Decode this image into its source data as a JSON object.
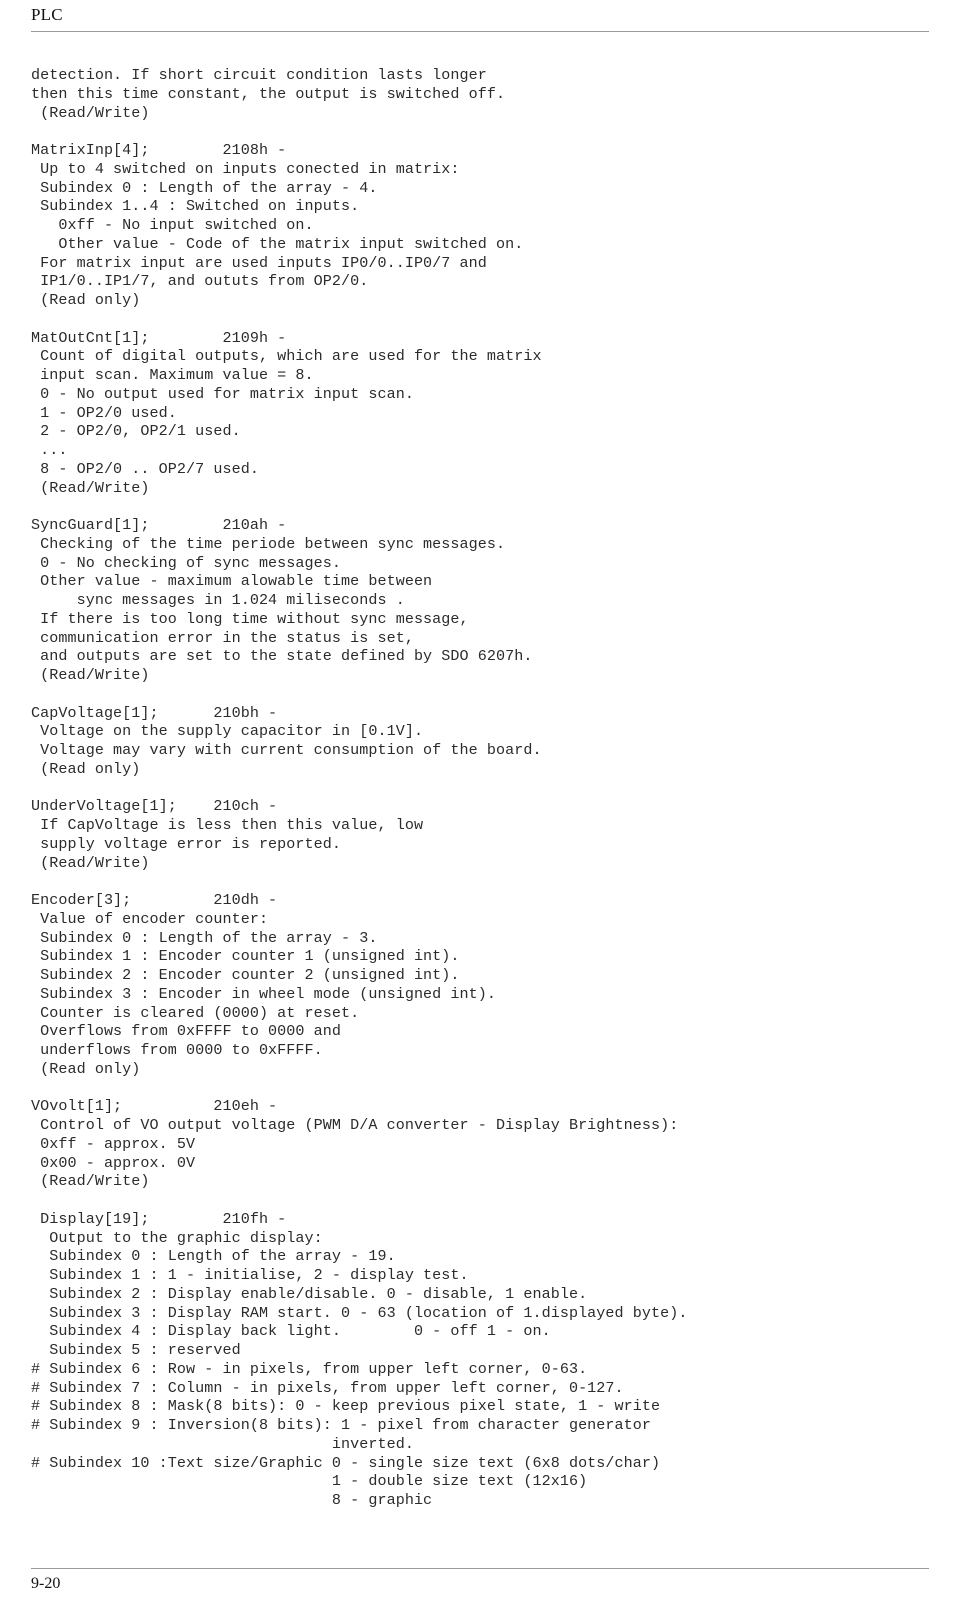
{
  "header": {
    "title": "PLC"
  },
  "footer": {
    "page_number": "9-20"
  },
  "document": {
    "lines": [
      "detection. If short circuit condition lasts longer",
      "then this time constant, the output is switched off.",
      " (Read/Write)",
      "",
      "MatrixInp[4];        2108h -",
      " Up to 4 switched on inputs conected in matrix:",
      " Subindex 0 : Length of the array - 4.",
      " Subindex 1..4 : Switched on inputs.",
      "   0xff - No input switched on.",
      "   Other value - Code of the matrix input switched on.",
      " For matrix input are used inputs IP0/0..IP0/7 and",
      " IP1/0..IP1/7, and oututs from OP2/0.",
      " (Read only)",
      "",
      "MatOutCnt[1];        2109h -",
      " Count of digital outputs, which are used for the matrix",
      " input scan. Maximum value = 8.",
      " 0 - No output used for matrix input scan.",
      " 1 - OP2/0 used.",
      " 2 - OP2/0, OP2/1 used.",
      " ...",
      " 8 - OP2/0 .. OP2/7 used.",
      " (Read/Write)",
      "",
      "SyncGuard[1];        210ah -",
      " Checking of the time periode between sync messages.",
      " 0 - No checking of sync messages.",
      " Other value - maximum alowable time between",
      "     sync messages in 1.024 miliseconds .",
      " If there is too long time without sync message,",
      " communication error in the status is set,",
      " and outputs are set to the state defined by SDO 6207h.",
      " (Read/Write)",
      "",
      "CapVoltage[1];      210bh -",
      " Voltage on the supply capacitor in [0.1V].",
      " Voltage may vary with current consumption of the board.",
      " (Read only)",
      "",
      "UnderVoltage[1];    210ch -",
      " If CapVoltage is less then this value, low",
      " supply voltage error is reported.",
      " (Read/Write)",
      "",
      "Encoder[3];         210dh -",
      " Value of encoder counter:",
      " Subindex 0 : Length of the array - 3.",
      " Subindex 1 : Encoder counter 1 (unsigned int).",
      " Subindex 2 : Encoder counter 2 (unsigned int).",
      " Subindex 3 : Encoder in wheel mode (unsigned int).",
      " Counter is cleared (0000) at reset.",
      " Overflows from 0xFFFF to 0000 and",
      " underflows from 0000 to 0xFFFF.",
      " (Read only)",
      "",
      "VOvolt[1];          210eh -",
      " Control of VO output voltage (PWM D/A converter - Display Brightness):",
      " 0xff - approx. 5V",
      " 0x00 - approx. 0V",
      " (Read/Write)",
      "",
      " Display[19];        210fh -",
      "  Output to the graphic display:",
      "  Subindex 0 : Length of the array - 19.",
      "  Subindex 1 : 1 - initialise, 2 - display test.",
      "  Subindex 2 : Display enable/disable. 0 - disable, 1 enable.",
      "  Subindex 3 : Display RAM start. 0 - 63 (location of 1.displayed byte).",
      "  Subindex 4 : Display back light.        0 - off 1 - on.",
      "  Subindex 5 : reserved",
      "# Subindex 6 : Row - in pixels, from upper left corner, 0-63.",
      "# Subindex 7 : Column - in pixels, from upper left corner, 0-127.",
      "# Subindex 8 : Mask(8 bits): 0 - keep previous pixel state, 1 - write",
      "# Subindex 9 : Inversion(8 bits): 1 - pixel from character generator",
      "                                 inverted.",
      "# Subindex 10 :Text size/Graphic 0 - single size text (6x8 dots/char)",
      "                                 1 - double size text (12x16)",
      "                                 8 - graphic"
    ]
  },
  "colors": {
    "text": "#2b2b2b",
    "heading": "#111111",
    "rule": "#9a9a9a",
    "background": "#ffffff"
  }
}
